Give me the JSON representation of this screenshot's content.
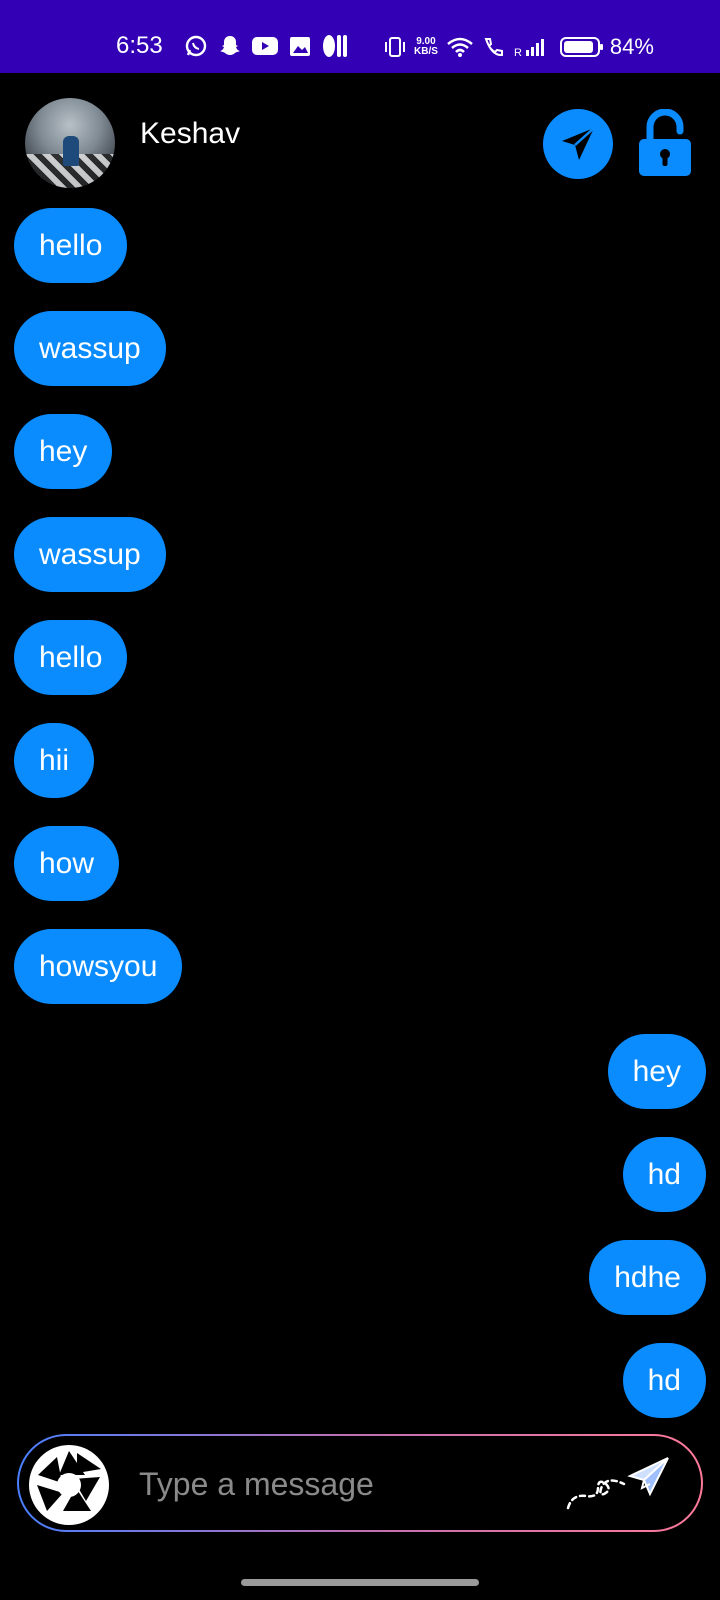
{
  "status_bar": {
    "time": "6:53",
    "net_speed_value": "9.00",
    "net_speed_unit": "KB/S",
    "battery": "84%",
    "icons": [
      "whatsapp-icon",
      "snapchat-icon",
      "youtube-icon",
      "gallery-icon",
      "pill-icon",
      "vibrate-icon",
      "wifi-icon",
      "wifi-call-icon",
      "signal-icon",
      "battery-icon"
    ]
  },
  "header": {
    "contact_name": "Keshav"
  },
  "messages": [
    {
      "side": "in",
      "text": "hello"
    },
    {
      "side": "in",
      "text": "wassup"
    },
    {
      "side": "in",
      "text": "hey"
    },
    {
      "side": "in",
      "text": "wassup"
    },
    {
      "side": "in",
      "text": "hello"
    },
    {
      "side": "in",
      "text": "hii"
    },
    {
      "side": "in",
      "text": "how"
    },
    {
      "side": "in",
      "text": "howsyou"
    },
    {
      "side": "out",
      "text": "hey"
    },
    {
      "side": "out",
      "text": "hd"
    },
    {
      "side": "out",
      "text": "hdhe"
    },
    {
      "side": "out",
      "text": "hd"
    }
  ],
  "composer": {
    "placeholder": "Type a message",
    "value": ""
  },
  "colors": {
    "status_bar": "#3300b5",
    "accent": "#0a8cff",
    "background": "#000000"
  }
}
